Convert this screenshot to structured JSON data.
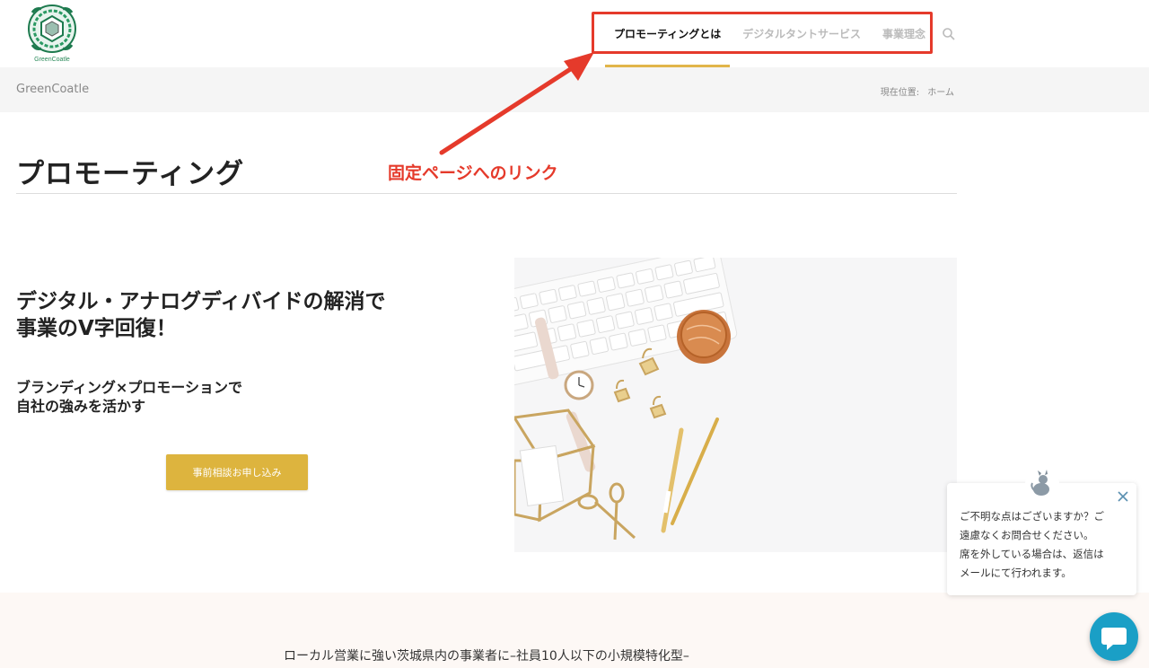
{
  "header": {
    "logo_text": "GreenCoatle",
    "nav": [
      {
        "label": "プロモーティングとは",
        "active": true
      },
      {
        "label": "デジタルタントサービス",
        "active": false
      },
      {
        "label": "事業理念",
        "active": false
      }
    ]
  },
  "annotation": {
    "label": "固定ページへのリンク",
    "color": "#e53a2b"
  },
  "breadcrumb_bar": {
    "site_name": "GreenCoatle",
    "location_label": "現在位置:",
    "home_label": "ホーム"
  },
  "page": {
    "title": "プロモーティング"
  },
  "hero": {
    "headline_line1": "デジタル・アナログディバイドの解消で",
    "headline_line2": "事業のV字回復！",
    "sub_line1": "ブランディング×プロモーションで",
    "sub_line2": "自社の強みを活かす",
    "cta_label": "事前相談お申し込み",
    "accent_color": "#ddb43e"
  },
  "band": {
    "tagline": "ローカル営業に強い茨城県内の事業者に–社員10人以下の小規模特化型–"
  },
  "chat": {
    "message_line1": "ご不明な点はございますか？ご",
    "message_line2": "遠慮なくお問合せください。",
    "message_line3": "席を外している場合は、返信は",
    "message_line4": "メールにて行われます。",
    "button_color": "#1a9fc6"
  }
}
